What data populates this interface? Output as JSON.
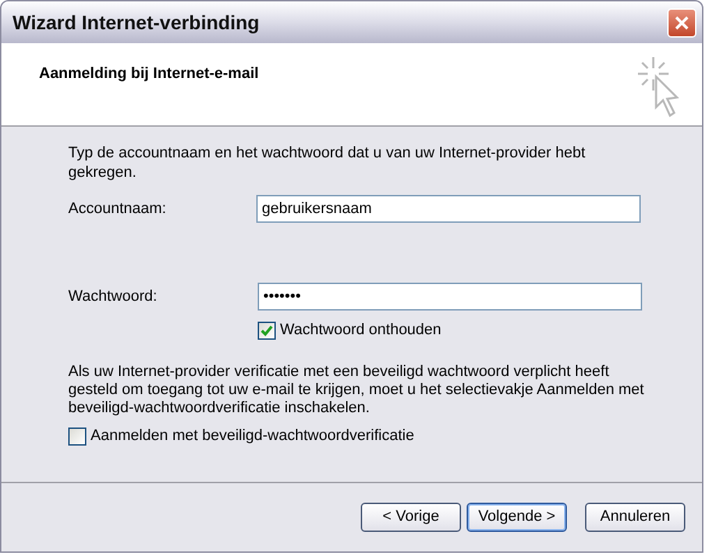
{
  "window": {
    "title": "Wizard Internet-verbinding"
  },
  "header": {
    "title": "Aanmelding bij Internet-e-mail"
  },
  "intro": "Typ de accountnaam en het wachtwoord dat u van uw Internet-provider hebt gekregen.",
  "account": {
    "label": "Accountnaam:",
    "value": "gebruikersnaam"
  },
  "password": {
    "label": "Wachtwoord:",
    "value": "•••••••"
  },
  "remember": {
    "label": "Wachtwoord onthouden",
    "checked": true
  },
  "note": "Als uw Internet-provider verificatie met een beveiligd wachtwoord verplicht heeft gesteld om toegang tot uw e-mail te krijgen, moet u het selectievakje Aanmelden met beveiligd-wachtwoordverificatie inschakelen.",
  "spa": {
    "label": "Aanmelden met beveiligd-wachtwoordverificatie",
    "checked": false
  },
  "buttons": [
    {
      "label": "< Vorige",
      "selected": false
    },
    {
      "label": "Volgende >",
      "selected": true
    },
    {
      "label": "Annuleren",
      "selected": false
    }
  ]
}
